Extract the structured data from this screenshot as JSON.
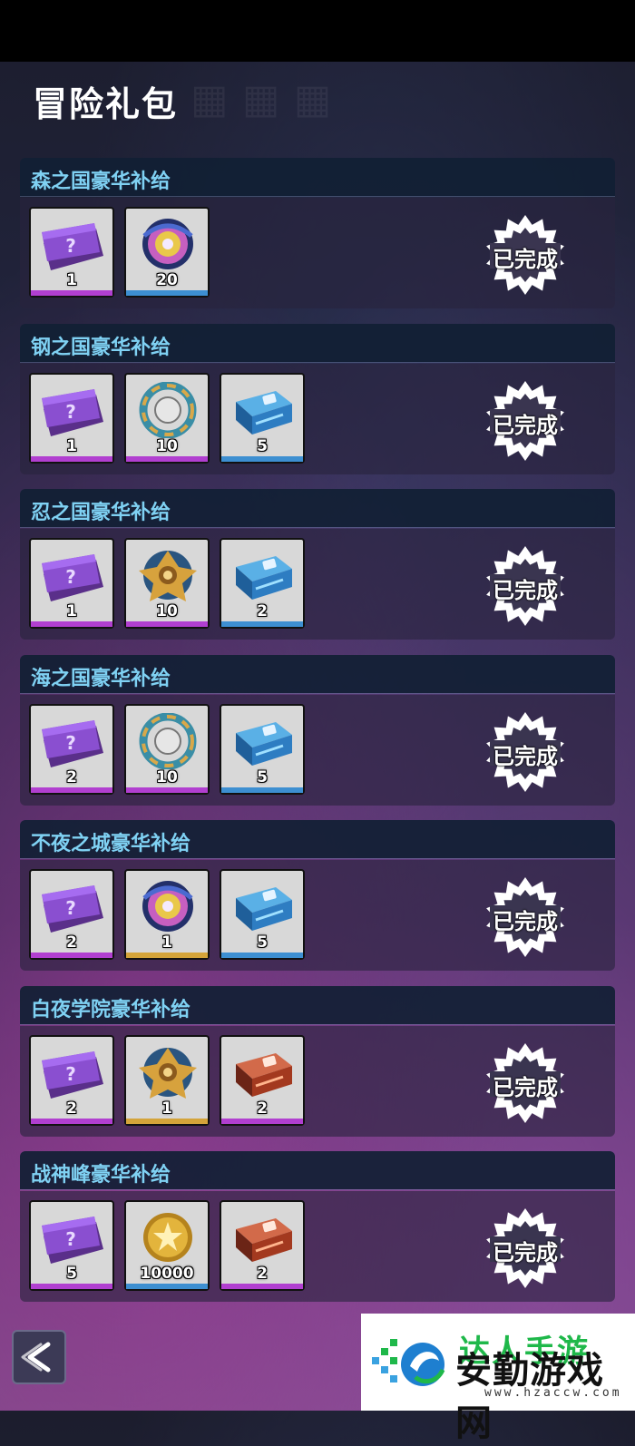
{
  "page": {
    "title": "冒险礼包"
  },
  "colors": {
    "bar_purple": "#b13fd0",
    "bar_blue": "#3d8fd1",
    "bar_gold": "#d4a43a",
    "section_title": "#7fd1f3"
  },
  "sections": [
    {
      "title": "森之国豪华补给",
      "status": "已完成",
      "items": [
        {
          "icon": "purple-ticket-icon",
          "qty": "1",
          "bar": "purple"
        },
        {
          "icon": "beyblade-icon",
          "qty": "20",
          "bar": "blue"
        }
      ]
    },
    {
      "title": "钢之国豪华补给",
      "status": "已完成",
      "items": [
        {
          "icon": "purple-ticket-icon",
          "qty": "1",
          "bar": "purple"
        },
        {
          "icon": "beyblade-ring-icon",
          "qty": "10",
          "bar": "purple"
        },
        {
          "icon": "blue-chest-icon",
          "qty": "5",
          "bar": "blue"
        }
      ]
    },
    {
      "title": "忍之国豪华补给",
      "status": "已完成",
      "items": [
        {
          "icon": "purple-ticket-icon",
          "qty": "1",
          "bar": "purple"
        },
        {
          "icon": "beyblade-gold-icon",
          "qty": "10",
          "bar": "purple"
        },
        {
          "icon": "blue-chest-icon",
          "qty": "2",
          "bar": "blue"
        }
      ]
    },
    {
      "title": "海之国豪华补给",
      "status": "已完成",
      "items": [
        {
          "icon": "purple-ticket-icon",
          "qty": "2",
          "bar": "purple"
        },
        {
          "icon": "beyblade-ring-icon",
          "qty": "10",
          "bar": "purple"
        },
        {
          "icon": "blue-chest-icon",
          "qty": "5",
          "bar": "blue"
        }
      ]
    },
    {
      "title": "不夜之城豪华补给",
      "status": "已完成",
      "items": [
        {
          "icon": "purple-ticket-icon",
          "qty": "2",
          "bar": "purple"
        },
        {
          "icon": "beyblade-icon",
          "qty": "1",
          "bar": "gold"
        },
        {
          "icon": "blue-chest-icon",
          "qty": "5",
          "bar": "blue"
        }
      ]
    },
    {
      "title": "白夜学院豪华补给",
      "status": "已完成",
      "items": [
        {
          "icon": "purple-ticket-icon",
          "qty": "2",
          "bar": "purple"
        },
        {
          "icon": "beyblade-gold-icon",
          "qty": "1",
          "bar": "gold"
        },
        {
          "icon": "red-chest-icon",
          "qty": "2",
          "bar": "purple"
        }
      ]
    },
    {
      "title": "战神峰豪华补给",
      "status": "已完成",
      "items": [
        {
          "icon": "purple-ticket-icon",
          "qty": "5",
          "bar": "purple"
        },
        {
          "icon": "gold-coin-icon",
          "qty": "10000",
          "bar": "blue"
        },
        {
          "icon": "red-chest-icon",
          "qty": "2",
          "bar": "purple"
        }
      ]
    }
  ],
  "watermark": {
    "top": "达人手游",
    "main": "安勤游戏网",
    "url": "www.hzaccw.com"
  }
}
